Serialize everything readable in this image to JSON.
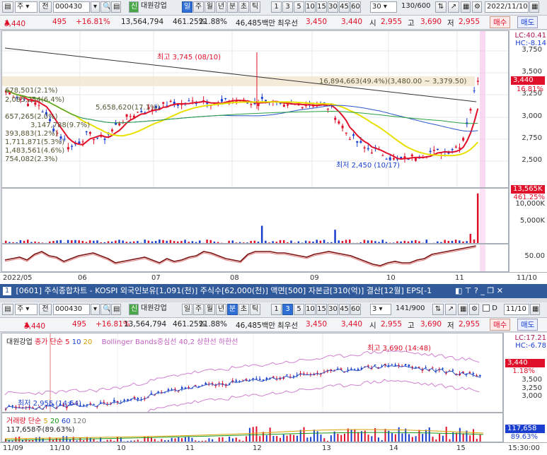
{
  "top": {
    "toolbar": {
      "mode": "주",
      "kind": "전",
      "code": "000430",
      "badge": "신",
      "name": "대원강업",
      "periods": [
        "일",
        "주",
        "월",
        "년",
        "분",
        "초",
        "틱"
      ],
      "selected_period": "일",
      "numbers": [
        "1",
        "3",
        "5",
        "10",
        "15",
        "30",
        "45",
        "60"
      ],
      "interval": "30",
      "count": "130/600",
      "date": "2022/11/10"
    },
    "quote": {
      "price": "3,440",
      "change": "495",
      "rate": "+16.81%",
      "volume": "13,564,794",
      "vol_rate": "461.25%",
      "turnover": "21.88%",
      "amount": "46,485백만",
      "best_label": "최우선",
      "ask": "3,450",
      "bid": "3,440",
      "open_label": "시",
      "open": "2,955",
      "high_label": "고",
      "high": "3,690",
      "low_label": "저",
      "low": "2,955",
      "buy": "매수",
      "sell": "매도"
    },
    "annotations": {
      "high": "최고 3,745 (08/10)",
      "low": "최저 2,450 (10/17)",
      "vol_profile_top": "16,894,663(49.4%)(3,480.00 ~ 3,379.50)",
      "mid": "5,658,620(17.1%)"
    },
    "profile_labels": [
      "678,501(2.1%)",
      "2,085,254(6.4%)",
      "657,265(2.0%)",
      "3,147,788(9.7%)",
      "393,883(1.2%)",
      "1,711,871(5.3%)",
      "1,483,561(4.6%)",
      "754,082(2.3%)"
    ],
    "right_info": {
      "lc": "LC:40.41",
      "hc": "HC:-8.14"
    },
    "y_ticks": [
      "3,750",
      "3,500",
      "3,250",
      "3,000",
      "2,750",
      "2,500"
    ],
    "price_tag": "3,440",
    "rate_tag": "16.81%",
    "vol_tag": "13,565K",
    "vol_rate_tag": "461.25%",
    "vol_ticks": [
      "10,000K",
      "5,000K"
    ],
    "osc_tick": "50.00",
    "x_labels": [
      "2022/05",
      "06",
      "07",
      "08",
      "09",
      "10",
      "11",
      "11/10"
    ]
  },
  "window_title": "[0601] 주식종합차트 - KOSPI 외국인보유[1,091(천)] 주식수[62,000(천)] 액면[500] 자본금[310(억)] 결산[12월] EPS[-1",
  "window_num": "1",
  "bottom": {
    "toolbar": {
      "mode": "주",
      "kind": "전",
      "code": "000430",
      "badge": "신",
      "name": "대원강업",
      "periods": [
        "일",
        "주",
        "월",
        "년",
        "분",
        "초",
        "틱"
      ],
      "selected_period": "분",
      "numbers": [
        "1",
        "3",
        "5",
        "10",
        "15",
        "30",
        "45",
        "60"
      ],
      "selected_number": "3",
      "interval": "3",
      "count": "141/900",
      "date": "11/10",
      "check_label": "D"
    },
    "legend": {
      "name": "대원강업",
      "ma_label": "종가 단순",
      "ma": [
        "5",
        "10",
        "20"
      ],
      "bb": "Bollinger Bands중심선 40,2  상한선  하한선"
    },
    "annotations": {
      "high": "최고 3,690 (14:48)",
      "low": "최저 2,955 (14:54)"
    },
    "right_info": {
      "lc": "LC:17.21",
      "hc": "HC:-6.78"
    },
    "y_ticks": [
      "3,500",
      "3,250",
      "3,000"
    ],
    "price_tag": "3,440",
    "rate_tag": "1.18%",
    "vol_legend": {
      "label": "거래량 단순",
      "ma": [
        "5",
        "20",
        "60",
        "120"
      ],
      "value": "117,658주(89.63%)"
    },
    "vol_tag": "117,658",
    "vol_rate_tag": "89.63%",
    "x_labels": [
      "11/09",
      "11/10",
      "10",
      "11",
      "12",
      "13",
      "14",
      "15",
      "15:30:00"
    ]
  }
}
